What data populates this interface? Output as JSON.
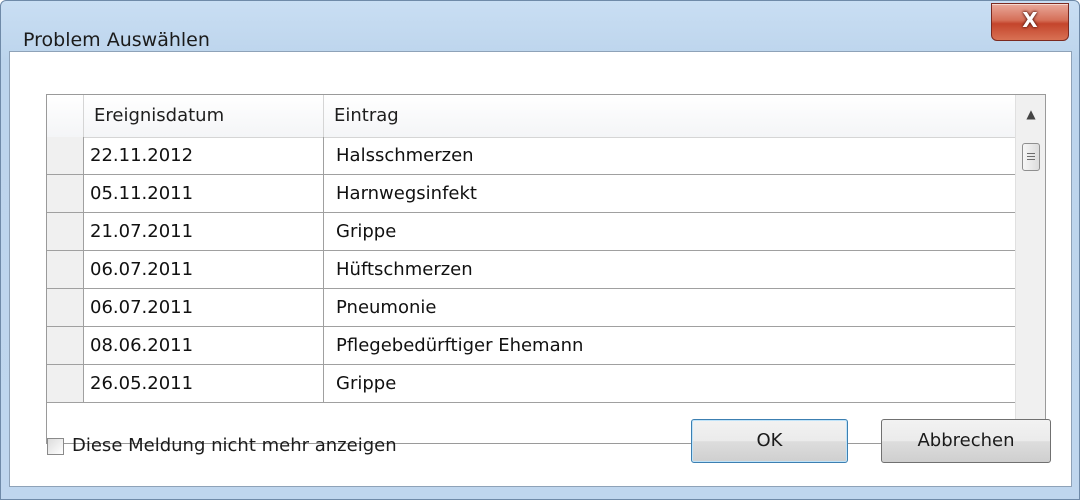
{
  "window": {
    "title": "Problem Auswählen",
    "close_glyph": "X"
  },
  "grid": {
    "columns": [
      "Ereignisdatum",
      "Eintrag"
    ],
    "rows": [
      {
        "date": "22.11.2012",
        "entry": "Halsschmerzen"
      },
      {
        "date": "05.11.2011",
        "entry": "Harnwegsinfekt"
      },
      {
        "date": "21.07.2011",
        "entry": "Grippe"
      },
      {
        "date": "06.07.2011",
        "entry": "Hüftschmerzen"
      },
      {
        "date": "06.07.2011",
        "entry": "Pneumonie"
      },
      {
        "date": "08.06.2011",
        "entry": "Pflegebedürftiger Ehemann"
      },
      {
        "date": "26.05.2011",
        "entry": "Grippe"
      }
    ]
  },
  "footer": {
    "checkbox_label": "Diese Meldung nicht mehr anzeigen",
    "checkbox_checked": false,
    "ok_label": "OK",
    "cancel_label": "Abbrechen"
  },
  "colors": {
    "frame": "#bfd6ee",
    "close_button": "#c4452c",
    "default_button_border": "#3c7fb1"
  }
}
